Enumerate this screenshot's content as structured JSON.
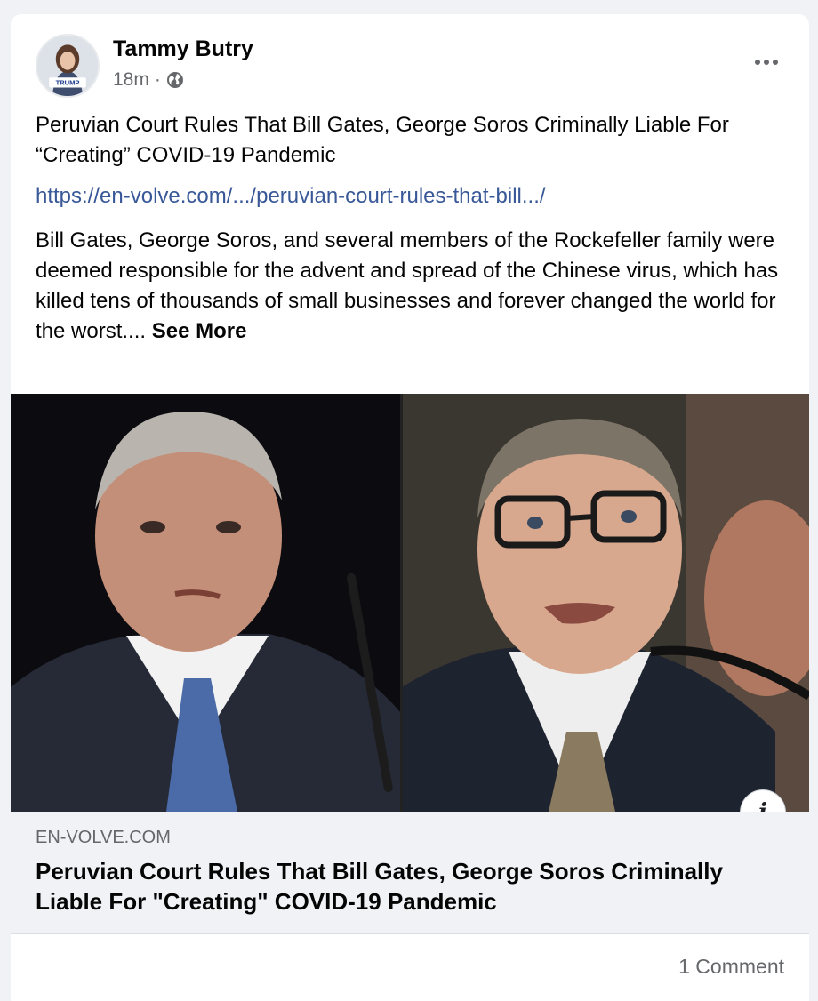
{
  "post": {
    "author": "Tammy Butry",
    "time": "18m",
    "separator": "·",
    "audience_icon": "globe-icon",
    "headline": "Peruvian Court Rules That Bill Gates, George Soros Criminally Liable For “Creating” COVID-19 Pandemic",
    "link_text": "https://en-volve.com/.../peruvian-court-rules-that-bill.../",
    "body": "Bill Gates, George Soros, and several members of the Rockefeller family were deemed responsible for the advent and spread of the Chinese virus, which has killed tens of thousands of small businesses and forever changed the world for the worst.... ",
    "see_more": "See More"
  },
  "avatar": {
    "badge_text": "TRUMP"
  },
  "link_preview": {
    "domain": "EN-VOLVE.COM",
    "title": "Peruvian Court Rules That Bill Gates, George Soros Criminally Liable For \"Creating\" COVID-19 Pandemic",
    "info_icon": "i"
  },
  "footer": {
    "comments": "1 Comment"
  },
  "colors": {
    "background": "#f0f2f5",
    "card": "#ffffff",
    "link": "#385898",
    "secondary_text": "#65676b"
  }
}
